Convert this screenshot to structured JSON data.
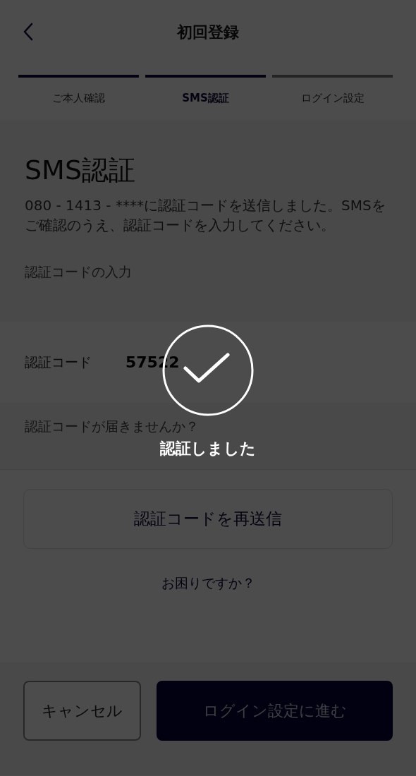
{
  "header": {
    "title": "初回登録"
  },
  "steps": [
    {
      "label": "ご本人確認",
      "done": true,
      "selected": false
    },
    {
      "label": "SMS認証",
      "done": true,
      "selected": true
    },
    {
      "label": "ログイン設定",
      "done": false,
      "selected": false
    }
  ],
  "heading": "SMS認証",
  "message": "080 - 1413 - ****に認証コードを送信しました。SMSをご確認のうえ、認証コードを入力してください。",
  "code_section_label": "認証コードの入力",
  "code_field": {
    "label": "認証コード",
    "value": "57522"
  },
  "resend_prompt": "認証コードが届きませんか？",
  "resend_button": "認証コードを再送信",
  "help_link": "お困りですか？",
  "footer": {
    "cancel_button": "キャンセル",
    "next_button": "ログイン設定に進む"
  },
  "toast": {
    "message": "認証しました"
  }
}
